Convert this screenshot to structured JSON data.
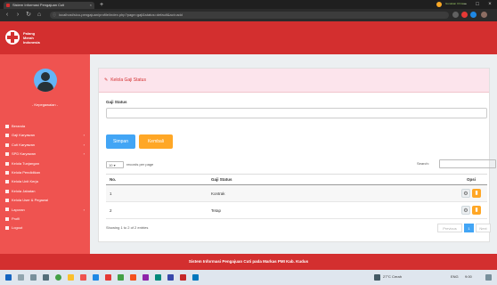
{
  "browser": {
    "tab_title": "Sistem Informasi Pengajuan Cuti",
    "tab_close": "×",
    "new_tab": "+",
    "url": "localhost/sicu-pengajuan/profile/index.php?page=gaji&status=default&act=add",
    "win_min": "–",
    "win_max": "□",
    "win_close": "×",
    "profile_text": "Gunakan Chrome"
  },
  "app": {
    "logo_text_1": "Palang",
    "logo_text_2": "Merah",
    "logo_text_3": "Indonesia",
    "brand_color": "#d32f2f"
  },
  "sidebar": {
    "role": "- Kepegawaian -",
    "items": [
      {
        "label": "Beranda",
        "has_caret": false
      },
      {
        "label": "Gaji Karyawan",
        "has_caret": true
      },
      {
        "label": "Cuti Karyawan",
        "has_caret": true
      },
      {
        "label": "SPD Karyawan",
        "has_caret": true
      },
      {
        "label": "Kelola Tunjangan",
        "has_caret": false
      },
      {
        "label": "Kelola Pendidikan",
        "has_caret": false
      },
      {
        "label": "Kelola Unit Kerja",
        "has_caret": false
      },
      {
        "label": "Kelola Jabatan",
        "has_caret": false
      },
      {
        "label": "Kelola User & Pegawai",
        "has_caret": false
      },
      {
        "label": "Laporan",
        "has_caret": true
      },
      {
        "label": "Profil",
        "has_caret": false
      },
      {
        "label": "Logout",
        "has_caret": false
      }
    ]
  },
  "main": {
    "card_title": "Kelola Gaji Status",
    "field_label": "Gaji Status",
    "field_value": "",
    "save_label": "Simpan",
    "back_label": "Kembali",
    "length_value": "10",
    "length_suffix": "records per page",
    "search_label": "Search:",
    "columns": [
      "No.",
      "Gaji Status",
      "Opsi"
    ],
    "rows": [
      {
        "no": "1",
        "status": "Kontrak"
      },
      {
        "no": "2",
        "status": "Tetap"
      }
    ],
    "info": "Showing 1 to 2 of 2 entries",
    "pager": {
      "prev": "Previous",
      "page": "1",
      "next": "Next"
    }
  },
  "footer": {
    "text": "Sistem Informasi Pengajuan Cuti pada Markas PMI Kab. Kudus"
  },
  "taskbar": {
    "weather": "27°C Cerah",
    "lang": "ENG",
    "time": "9:00"
  }
}
